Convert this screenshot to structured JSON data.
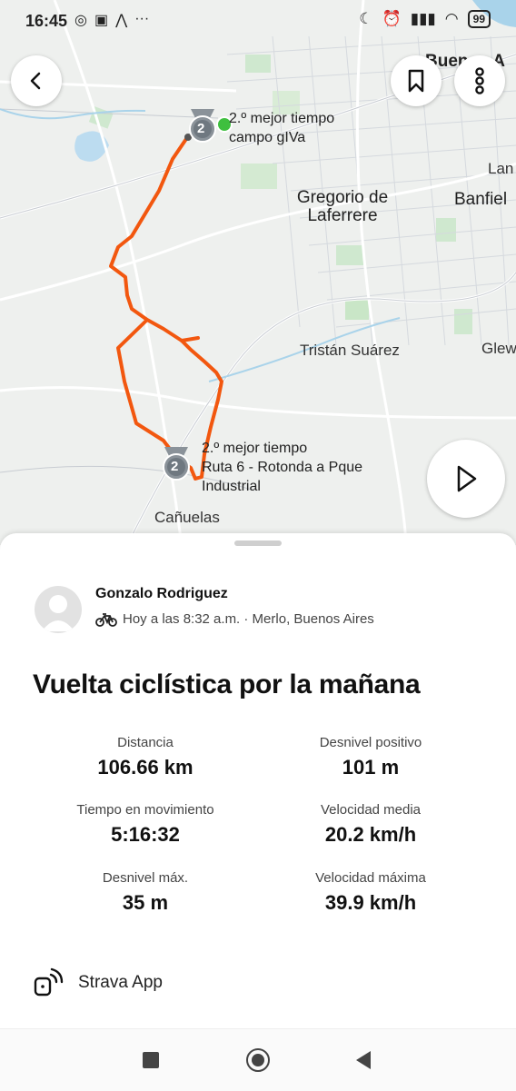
{
  "status_bar": {
    "time": "16:45",
    "battery": "99"
  },
  "map": {
    "labels": {
      "city_top": "Buenos A",
      "gregorio": "Gregorio de\nLaferrere",
      "banfield": "Banfiel",
      "lanus": "Lan",
      "tristan": "Tristán Suárez",
      "glew": "Glew",
      "canuelas": "Cañuelas"
    },
    "segment_1": {
      "rank": "2",
      "title": "2.º mejor tiempo",
      "name": "campo gIVa"
    },
    "segment_2": {
      "rank": "2",
      "title": "2.º mejor tiempo",
      "name": "Ruta 6 - Rotonda a Pque",
      "name_2": "Industrial"
    },
    "route_color": "#f2570f"
  },
  "activity": {
    "athlete": "Gonzalo Rodriguez",
    "meta": "Hoy a las 8:32 a.m. · Merlo, Buenos Aires",
    "title": "Vuelta ciclística por la mañana",
    "stats": [
      {
        "label": "Distancia",
        "value": "106.66 km"
      },
      {
        "label": "Desnivel positivo",
        "value": "101 m"
      },
      {
        "label": "Tiempo en movimiento",
        "value": "5:16:32"
      },
      {
        "label": "Velocidad media",
        "value": "20.2 km/h"
      },
      {
        "label": "Desnivel máx.",
        "value": "35 m"
      },
      {
        "label": "Velocidad máxima",
        "value": "39.9 km/h"
      }
    ],
    "device": "Strava App"
  }
}
